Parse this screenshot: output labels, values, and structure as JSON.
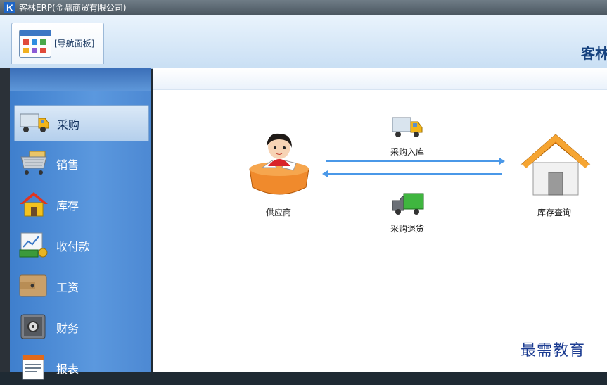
{
  "window": {
    "title": "客林ERP(金鼎商贸有限公司)",
    "logo_letter": "K"
  },
  "ribbon": {
    "nav_tab_label": "[导航面板]",
    "brand_text": "客林"
  },
  "sidebar": {
    "items": [
      {
        "label": "采购",
        "icon": "truck-icon",
        "active": true
      },
      {
        "label": "销售",
        "icon": "shopping-cart-icon"
      },
      {
        "label": "库存",
        "icon": "house-icon"
      },
      {
        "label": "收付款",
        "icon": "money-chart-icon"
      },
      {
        "label": "工资",
        "icon": "wallet-icon"
      },
      {
        "label": "财务",
        "icon": "safe-icon"
      },
      {
        "label": "报表",
        "icon": "report-icon"
      }
    ]
  },
  "flow": {
    "supplier": {
      "label": "供应商",
      "icon": "supplier-person-icon"
    },
    "purchase_in": {
      "label": "采购入库",
      "icon": "truck-icon"
    },
    "purchase_return": {
      "label": "采购退货",
      "icon": "green-truck-icon"
    },
    "inventory": {
      "label": "库存查询",
      "icon": "house-icon"
    }
  },
  "watermark": "最需教育",
  "colors": {
    "sidebar": "#4d89d3",
    "arrow": "#4a98e8",
    "brand": "#16427f"
  }
}
